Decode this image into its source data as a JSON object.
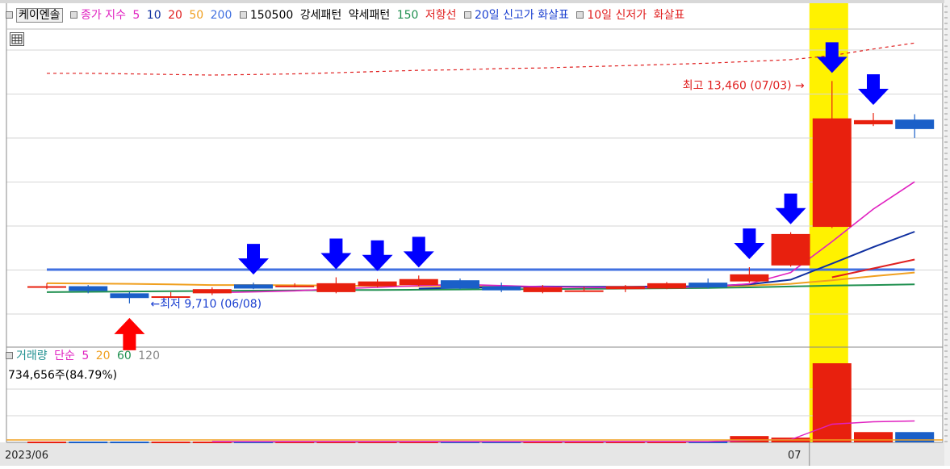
{
  "legend_price": {
    "stock": "케이엔솔",
    "close_index": "종가 지수",
    "ma5": "5",
    "ma10": "10",
    "ma20": "20",
    "ma50": "50",
    "ma200": "200",
    "code": "150500",
    "strong_pattern": "강세패턴",
    "weak_pattern": "약세패턴",
    "ma150": "150",
    "resistance": "저항선",
    "high20_arrow": "20일 신고가 화살표",
    "low10_prefix": "10일 신저가",
    "low10_suffix": "화살표"
  },
  "legend_volume": {
    "title": "거래량",
    "simple": "단순",
    "v5": "5",
    "v20": "20",
    "v60": "60",
    "v120": "120",
    "current": "734,656주(84.79%)"
  },
  "annotations": {
    "high_label": "최고 13,460 (07/03) →",
    "low_label": "←최저 9,710 (06/08)"
  },
  "x_labels": {
    "start": "2023/06",
    "month": "07"
  },
  "colors": {
    "up": "#e8200e",
    "down": "#1a5fc8",
    "highlight": "#fff200",
    "arrow_blue": "#0000ff",
    "arrow_red": "#ff0000",
    "ma5": "#e020c0",
    "ma10": "#1030a0",
    "ma20": "#e02020",
    "ma50": "#f0a020",
    "ma200": "#4070e0",
    "ma150": "#209050",
    "resistance": "#e02020"
  },
  "chart_data": {
    "type": "candlestick",
    "stock": "케이엔솔",
    "y_range": [
      9000,
      14200
    ],
    "candles": [
      {
        "o": 10000,
        "h": 10050,
        "l": 9950,
        "c": 10000
      },
      {
        "o": 10000,
        "h": 10020,
        "l": 9880,
        "c": 9920
      },
      {
        "o": 9880,
        "h": 9900,
        "l": 9710,
        "c": 9800
      },
      {
        "o": 9830,
        "h": 9900,
        "l": 9800,
        "c": 9830
      },
      {
        "o": 9880,
        "h": 9980,
        "l": 9850,
        "c": 9950
      },
      {
        "o": 10030,
        "h": 10060,
        "l": 9950,
        "c": 9960
      },
      {
        "o": 10010,
        "h": 10050,
        "l": 9980,
        "c": 10010
      },
      {
        "o": 9900,
        "h": 10150,
        "l": 9880,
        "c": 10050
      },
      {
        "o": 10000,
        "h": 10120,
        "l": 9980,
        "c": 10080
      },
      {
        "o": 10020,
        "h": 10180,
        "l": 10000,
        "c": 10120
      },
      {
        "o": 10100,
        "h": 10130,
        "l": 9950,
        "c": 9960
      },
      {
        "o": 10000,
        "h": 10060,
        "l": 9900,
        "c": 9930
      },
      {
        "o": 9900,
        "h": 10020,
        "l": 9880,
        "c": 9980
      },
      {
        "o": 9930,
        "h": 9990,
        "l": 9920,
        "c": 9930
      },
      {
        "o": 9950,
        "h": 10020,
        "l": 9900,
        "c": 10000
      },
      {
        "o": 9960,
        "h": 10070,
        "l": 9950,
        "c": 10050
      },
      {
        "o": 10060,
        "h": 10130,
        "l": 9960,
        "c": 9980
      },
      {
        "o": 10080,
        "h": 10320,
        "l": 10060,
        "c": 10200
      },
      {
        "o": 10350,
        "h": 10910,
        "l": 10330,
        "c": 10880
      },
      {
        "o": 11000,
        "h": 13460,
        "l": 10980,
        "c": 12830
      },
      {
        "o": 12730,
        "h": 12920,
        "l": 12700,
        "c": 12800
      },
      {
        "o": 12810,
        "h": 12900,
        "l": 12500,
        "c": 12650
      }
    ],
    "ma5": [
      null,
      null,
      null,
      null,
      9890,
      9904,
      9922,
      9955,
      9980,
      10010,
      10030,
      10010,
      9990,
      9980,
      9970,
      9980,
      9990,
      10040,
      10230,
      10750,
      11300,
      11760
    ],
    "ma10": [
      null,
      null,
      null,
      null,
      null,
      null,
      null,
      null,
      null,
      9960,
      9975,
      9985,
      9995,
      9990,
      9990,
      9995,
      10000,
      10030,
      10110,
      10380,
      10660,
      10920
    ],
    "ma20": [
      null,
      null,
      null,
      null,
      null,
      null,
      null,
      null,
      null,
      null,
      null,
      null,
      null,
      null,
      null,
      null,
      null,
      null,
      null,
      10150,
      10300,
      10450
    ],
    "ma50": [
      10050,
      10045,
      10040,
      10030,
      10020,
      10020,
      10015,
      10010,
      10005,
      10000,
      10000,
      9995,
      9990,
      9985,
      9985,
      9990,
      9995,
      10010,
      10040,
      10100,
      10170,
      10230
    ],
    "ma150": [
      9900,
      9905,
      9910,
      9915,
      9920,
      9925,
      9930,
      9935,
      9935,
      9940,
      9945,
      9950,
      9950,
      9955,
      9960,
      9965,
      9970,
      9980,
      9995,
      10010,
      10020,
      10030
    ],
    "ma200": [
      10280,
      10280,
      10280,
      10280,
      10280,
      10280,
      10280,
      10280,
      10280,
      10280,
      10280,
      10280,
      10280,
      10280,
      10280,
      10280,
      10280,
      10280,
      10280,
      10280,
      10280,
      10280
    ],
    "resistance": [
      13590,
      13590,
      13580,
      13570,
      13560,
      13570,
      13580,
      13600,
      13620,
      13640,
      13650,
      13670,
      13680,
      13700,
      13720,
      13740,
      13760,
      13790,
      13820,
      13890,
      14000,
      14100
    ],
    "volume_ratio": [
      0.01,
      0.01,
      0.01,
      0.01,
      0.01,
      0.01,
      0.01,
      0.01,
      0.01,
      0.01,
      0.01,
      0.01,
      0.01,
      0.01,
      0.01,
      0.01,
      0.01,
      0.08,
      0.06,
      1.0,
      0.13,
      0.13
    ],
    "vol_ma5": [
      null,
      null,
      null,
      null,
      0.01,
      0.01,
      0.01,
      0.01,
      0.01,
      0.01,
      0.01,
      0.01,
      0.01,
      0.01,
      0.01,
      0.01,
      0.01,
      0.025,
      0.035,
      0.23,
      0.26,
      0.27
    ],
    "arrows_20d_high": [
      5,
      7,
      8,
      9,
      17,
      18,
      19,
      20
    ],
    "arrows_10d_low": [
      2
    ],
    "highlight_index": 19,
    "highest": {
      "value": 13460,
      "date": "07/03",
      "index": 19
    },
    "lowest": {
      "value": 9710,
      "date": "06/08",
      "index": 2
    },
    "current_volume": "734,656주(84.79%)",
    "x_axis": [
      "2023/06",
      "07"
    ]
  }
}
